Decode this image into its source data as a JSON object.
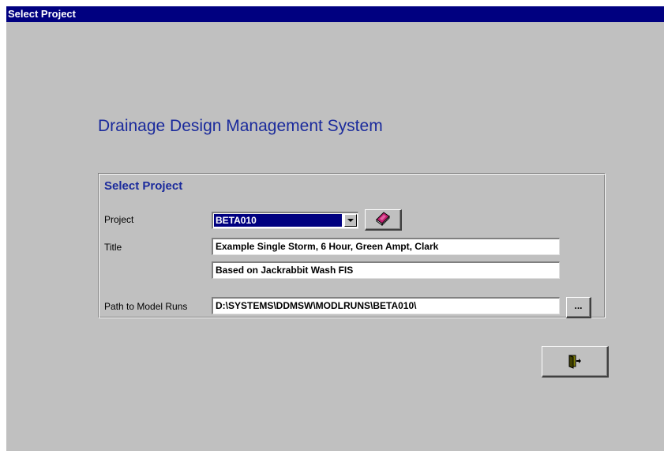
{
  "window": {
    "title": "Select Project"
  },
  "app": {
    "heading": "Drainage Design Management System"
  },
  "group": {
    "title": "Select Project",
    "project": {
      "label": "Project",
      "selected": "BETA010",
      "open_icon": "book-icon"
    },
    "title_field": {
      "label": "Title",
      "line1": "Example Single Storm, 6 Hour, Green Ampt, Clark",
      "line2": "Based on Jackrabbit Wash FIS"
    },
    "path": {
      "label": "Path to Model Runs",
      "value": "D:\\SYSTEMS\\DDMSW\\MODLRUNS\\BETA010\\",
      "browse_label": "..."
    }
  },
  "exit_button": {
    "icon": "exit-door-icon"
  },
  "colors": {
    "titlebar": "#000080",
    "heading": "#1a2a9c",
    "background": "#c0c0c0"
  }
}
